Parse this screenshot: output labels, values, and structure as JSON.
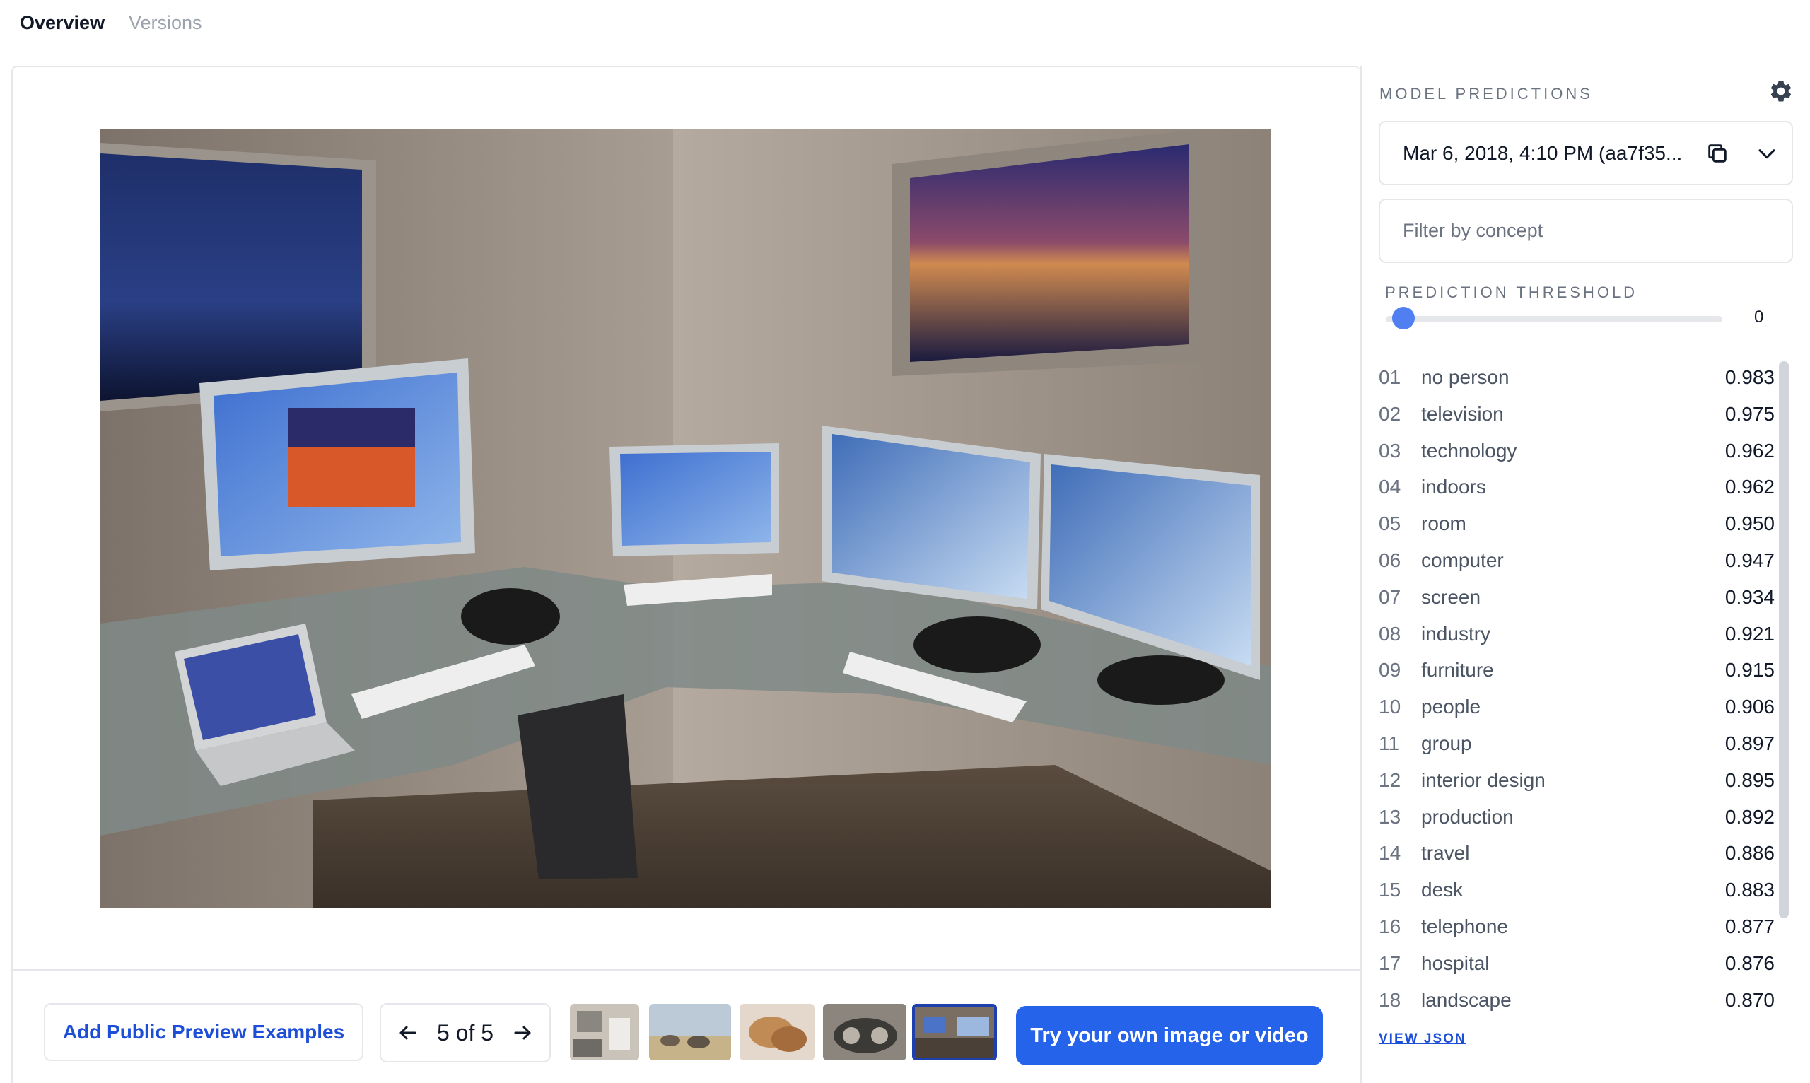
{
  "tabs": [
    {
      "label": "Overview",
      "active": true
    },
    {
      "label": "Versions",
      "active": false
    }
  ],
  "preview": {
    "description_icon": "photo-of-computer-workstation"
  },
  "bottom_bar": {
    "add_examples_label": "Add Public Preview Examples",
    "pager_text": "5 of 5",
    "try_label": "Try your own image or video",
    "thumbnails": [
      {
        "name": "thumbnail-1",
        "selected": false
      },
      {
        "name": "thumbnail-2",
        "selected": false
      },
      {
        "name": "thumbnail-3",
        "selected": false
      },
      {
        "name": "thumbnail-4",
        "selected": false
      },
      {
        "name": "thumbnail-5",
        "selected": true
      }
    ]
  },
  "sidebar": {
    "title": "MODEL PREDICTIONS",
    "version": "Mar 6, 2018, 4:10 PM (aa7f35...",
    "filter_placeholder": "Filter by concept",
    "threshold_label": "PREDICTION THRESHOLD",
    "threshold_value": "0",
    "view_json_label": "VIEW JSON",
    "predictions": [
      {
        "idx": "01",
        "name": "no person",
        "value": "0.983"
      },
      {
        "idx": "02",
        "name": "television",
        "value": "0.975"
      },
      {
        "idx": "03",
        "name": "technology",
        "value": "0.962"
      },
      {
        "idx": "04",
        "name": "indoors",
        "value": "0.962"
      },
      {
        "idx": "05",
        "name": "room",
        "value": "0.950"
      },
      {
        "idx": "06",
        "name": "computer",
        "value": "0.947"
      },
      {
        "idx": "07",
        "name": "screen",
        "value": "0.934"
      },
      {
        "idx": "08",
        "name": "industry",
        "value": "0.921"
      },
      {
        "idx": "09",
        "name": "furniture",
        "value": "0.915"
      },
      {
        "idx": "10",
        "name": "people",
        "value": "0.906"
      },
      {
        "idx": "11",
        "name": "group",
        "value": "0.897"
      },
      {
        "idx": "12",
        "name": "interior design",
        "value": "0.895"
      },
      {
        "idx": "13",
        "name": "production",
        "value": "0.892"
      },
      {
        "idx": "14",
        "name": "travel",
        "value": "0.886"
      },
      {
        "idx": "15",
        "name": "desk",
        "value": "0.883"
      },
      {
        "idx": "16",
        "name": "telephone",
        "value": "0.877"
      },
      {
        "idx": "17",
        "name": "hospital",
        "value": "0.876"
      },
      {
        "idx": "18",
        "name": "landscape",
        "value": "0.870"
      }
    ]
  },
  "colors": {
    "accent": "#2563eb",
    "link": "#1d4ed8",
    "border": "#e5e7eb"
  }
}
